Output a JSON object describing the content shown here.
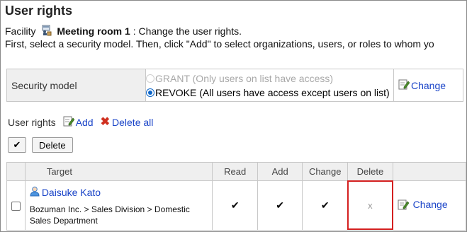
{
  "page": {
    "title": "User rights",
    "facility_prefix": "Facility",
    "facility_name": "Meeting room 1",
    "facility_suffix": " : Change the user rights.",
    "instruction": "First, select a security model. Then, click \"Add\" to select organizations, users, or roles to whom yo"
  },
  "security_model": {
    "label": "Security model",
    "options": [
      {
        "label": "GRANT (Only users on list have access)",
        "selected": false,
        "disabled": true
      },
      {
        "label": "REVOKE (All users have access except users on list)",
        "selected": true,
        "disabled": false
      }
    ],
    "change_label": "Change"
  },
  "user_rights": {
    "heading": "User rights",
    "add_label": "Add",
    "delete_all_label": "Delete all",
    "select_all_symbol": "✔",
    "delete_button_label": "Delete"
  },
  "table": {
    "headers": {
      "target": "Target",
      "read": "Read",
      "add": "Add",
      "change": "Change",
      "delete": "Delete"
    },
    "rows": [
      {
        "user_name": "Daisuke Kato",
        "path": "Bozuman Inc. > Sales Division > Domestic Sales Department",
        "read": "✔",
        "add": "✔",
        "change": "✔",
        "delete": "x",
        "change_label": "Change"
      }
    ]
  },
  "colors": {
    "link": "#1a44c8",
    "highlight_box": "#d42020",
    "radio_selected": "#0a64c8"
  }
}
